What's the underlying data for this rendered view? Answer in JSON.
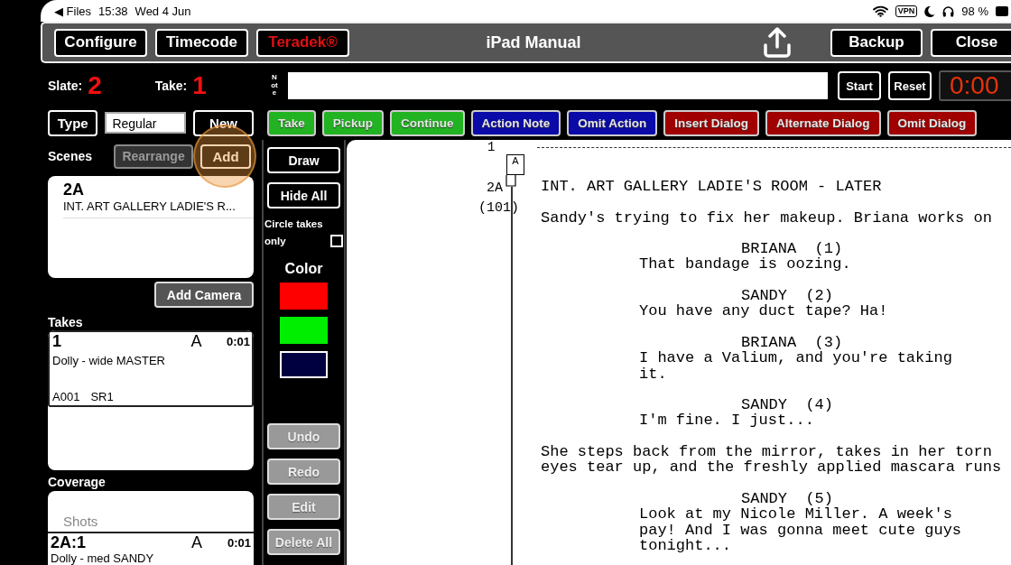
{
  "status_bar": {
    "back": "◀ Files",
    "time": "15:38",
    "date": "Wed 4 Jun",
    "vpn": "VPN",
    "battery": "98 %"
  },
  "toolbar": {
    "left_buttons": [
      {
        "label": "Configure",
        "kind": "normal"
      },
      {
        "label": "Timecode",
        "kind": "normal"
      },
      {
        "label": "Teradek®",
        "kind": "alert"
      }
    ],
    "title": "iPad Manual",
    "right_buttons": [
      "Backup",
      "Close"
    ]
  },
  "slate": {
    "label": "Slate:",
    "value": "2"
  },
  "take": {
    "label": "Take:",
    "value": "1"
  },
  "note": {
    "label": "Note"
  },
  "timer": {
    "buttons": [
      "Start",
      "Reset"
    ],
    "display": "0:00"
  },
  "type_row": {
    "button": "Type",
    "value": "Regular",
    "new_button": "New"
  },
  "scenes": {
    "label": "Scenes",
    "rearrange": {
      "label": "Rearrange",
      "disabled": true
    },
    "add": {
      "label": "Add",
      "touched": true
    }
  },
  "scene_list": [
    {
      "number": "2A",
      "heading": "INT. ART GALLERY LADIE'S R..."
    }
  ],
  "add_camera": "Add Camera",
  "takes": {
    "label": "Takes",
    "items": [
      {
        "number": "1",
        "camera": "A",
        "duration": "0:01",
        "description": "Dolly - wide MASTER",
        "clip": "A001",
        "sound": "SR1"
      }
    ]
  },
  "coverage": {
    "label": "Coverage",
    "header": "Shots",
    "items": [
      {
        "number": "2A:1",
        "camera": "A",
        "duration": "0:01",
        "description": "Dolly - med SANDY"
      }
    ]
  },
  "mark_buttons": [
    {
      "label": "Take",
      "color": "#22b322"
    },
    {
      "label": "Pickup",
      "color": "#22b322"
    },
    {
      "label": "Continue",
      "color": "#22b322"
    },
    {
      "label": "Action Note",
      "color": "#0a0aa8"
    },
    {
      "label": "Omit Action",
      "color": "#0a0aa8"
    },
    {
      "label": "Insert Dialog",
      "color": "#a00000"
    },
    {
      "label": "Alternate Dialog",
      "color": "#a00000"
    },
    {
      "label": "Omit Dialog",
      "color": "#a00000"
    }
  ],
  "tools": {
    "draw": "Draw",
    "hide_all": "Hide All",
    "circle_takes": {
      "label": "Circle takes only",
      "checked": false
    },
    "color_label": "Color",
    "colors": [
      {
        "color": "#ff0000",
        "selected": false
      },
      {
        "color": "#00ee00",
        "selected": false
      },
      {
        "color": "#000040",
        "selected": true
      }
    ],
    "actions": [
      {
        "label": "Undo",
        "disabled": true
      },
      {
        "label": "Redo",
        "disabled": true
      },
      {
        "label": "Edit",
        "disabled": true
      },
      {
        "label": "Delete All",
        "disabled": true
      }
    ]
  },
  "script": {
    "page_number": "1",
    "scene_number": "2A",
    "scene_page": "(101)",
    "camera_tag": "A",
    "paragraphs": [
      {
        "kind": "heading",
        "lines": [
          "INT. ART GALLERY LADIE'S ROOM - LATER"
        ]
      },
      {
        "kind": "action",
        "lines": [
          "Sandy's trying to fix her makeup. Briana works on"
        ]
      },
      {
        "kind": "character",
        "lines": [
          "BRIANA  (1)"
        ]
      },
      {
        "kind": "dialogue",
        "lines": [
          "That bandage is oozing."
        ]
      },
      {
        "kind": "character",
        "lines": [
          "SANDY  (2)"
        ]
      },
      {
        "kind": "dialogue",
        "lines": [
          "You have any duct tape? Ha!"
        ]
      },
      {
        "kind": "character",
        "lines": [
          "BRIANA  (3)"
        ]
      },
      {
        "kind": "dialogue",
        "lines": [
          "I have a Valium, and you're taking",
          "it."
        ]
      },
      {
        "kind": "character",
        "lines": [
          "SANDY  (4)"
        ]
      },
      {
        "kind": "dialogue",
        "lines": [
          "I'm fine. I just..."
        ]
      },
      {
        "kind": "action",
        "lines": [
          "She steps back from the mirror, takes in her torn",
          "eyes tear up, and the freshly applied mascara runs"
        ]
      },
      {
        "kind": "character",
        "lines": [
          "SANDY  (5)"
        ]
      },
      {
        "kind": "dialogue",
        "lines": [
          "Look at my Nicole Miller. A week's",
          "pay! And I was gonna meet cute guys",
          "tonight..."
        ]
      }
    ]
  }
}
